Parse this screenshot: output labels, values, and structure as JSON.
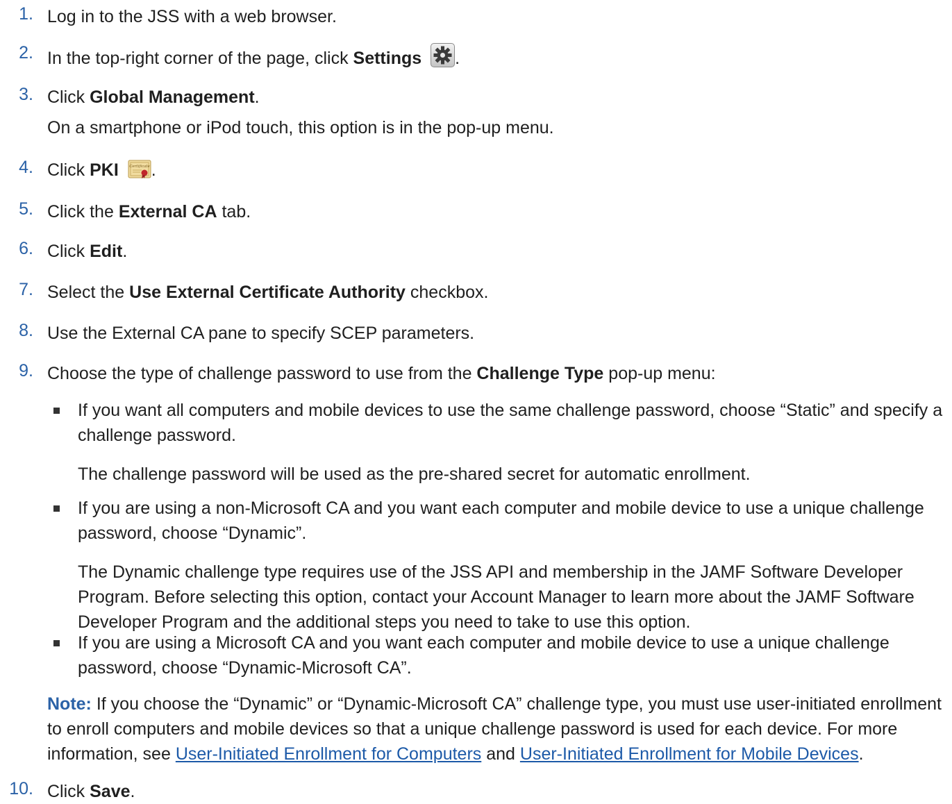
{
  "steps": [
    {
      "num": "1.",
      "text": "Log in to the JSS with a web browser."
    },
    {
      "num": "2.",
      "pre": "In the top-right corner of the page, click ",
      "bold": "Settings",
      "post": "."
    },
    {
      "num": "3.",
      "pre": "Click ",
      "bold": "Global Management",
      "post": ".",
      "sub": "On a smartphone or iPod touch, this option is in the pop-up menu."
    },
    {
      "num": "4.",
      "pre": "Click ",
      "bold": "PKI",
      "post": "."
    },
    {
      "num": "5.",
      "pre": "Click the ",
      "bold": "External CA",
      "post": " tab."
    },
    {
      "num": "6.",
      "pre": "Click ",
      "bold": "Edit",
      "post": "."
    },
    {
      "num": "7.",
      "pre": "Select the ",
      "bold": "Use External Certificate Authority",
      "post": " checkbox."
    },
    {
      "num": "8.",
      "text": "Use the External CA pane to specify SCEP parameters."
    },
    {
      "num": "9.",
      "pre": "Choose the type of challenge password to use from the ",
      "bold": "Challenge Type",
      "post": " pop-up menu:"
    },
    {
      "num": "10.",
      "pre": "Click ",
      "bold": "Save",
      "post": "."
    }
  ],
  "icons": {
    "settings": "gear-icon",
    "pki": "certificate-icon",
    "cert_label": "Certificate"
  },
  "bullets": [
    {
      "text": "If you want all computers and mobile devices to use the same challenge password, choose “Static” and specify a challenge password.",
      "sub": "The challenge password will be used as the pre-shared secret for automatic enrollment."
    },
    {
      "text": "If you are using a non-Microsoft CA and you want each computer and mobile device to use a unique challenge password, choose “Dynamic”.",
      "sub": "The Dynamic challenge type requires use of the JSS API and membership in the JAMF Software Developer Program. Before selecting this option, contact your Account Manager to learn more about the JAMF Software Developer Program and the additional steps you need to take to use this option."
    },
    {
      "text": "If you are using a Microsoft CA and you want each computer and mobile device to use a unique challenge password, choose “Dynamic-Microsoft CA”."
    }
  ],
  "note": {
    "label": "Note:",
    "text": " If you choose the “Dynamic” or “Dynamic-Microsoft CA” challenge type, you must use user-initiated enrollment to enroll computers and mobile devices so that a unique challenge password is used for each device. For more information, see ",
    "link1": "User-Initiated Enrollment for Computers",
    "between": " and ",
    "link2": "User-Initiated Enrollment for Mobile Devices",
    "end": "."
  },
  "colors": {
    "accent": "#2b62a7",
    "link": "#1d5aa8"
  }
}
